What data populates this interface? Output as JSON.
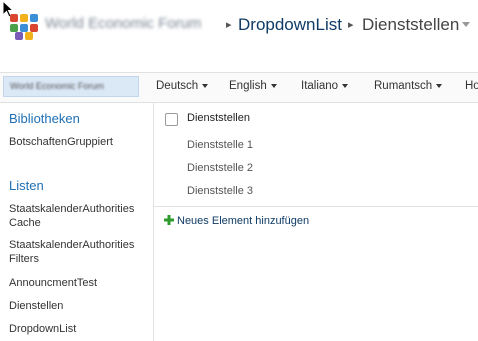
{
  "header": {
    "site_name": "World Economic Forum",
    "breadcrumb_list": "DropdownList",
    "breadcrumb_current": "Dienststellen"
  },
  "nav": {
    "home_label": "World Economic Forum",
    "items": [
      {
        "label": "Deutsch"
      },
      {
        "label": "English"
      },
      {
        "label": "Italiano"
      },
      {
        "label": "Rumantsch"
      },
      {
        "label": "Ho"
      }
    ]
  },
  "quicklaunch": {
    "libraries_heading": "Bibliotheken",
    "libraries": [
      "BotschaftenGruppiert"
    ],
    "lists_heading": "Listen",
    "lists": [
      "StaatskalenderAuthorities Cache",
      "StaatskalenderAuthorities Filters",
      "AnnouncmentTest",
      "Dienstellen",
      "DropdownList"
    ]
  },
  "main": {
    "column_header": "Dienststellen",
    "rows": [
      "Dienststelle 1",
      "Dienststelle 2",
      "Dienststelle 3"
    ],
    "add_link": "Neues Element hinzufügen"
  },
  "colors": {
    "link_blue": "#1f6fb3",
    "dark_blue": "#0f3b66",
    "add_green": "#2e9a2e"
  }
}
